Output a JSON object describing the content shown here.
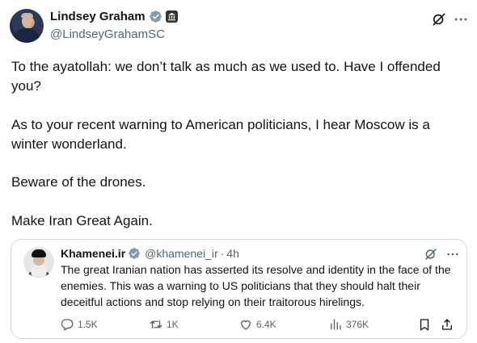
{
  "author": {
    "display_name": "Lindsey Graham",
    "handle": "@LindseyGrahamSC",
    "verified_color": "#829aab"
  },
  "tweet": {
    "paragraphs": [
      "To the ayatollah: we don’t talk as much as we used to. Have I offended you?",
      "As to your recent warning to American politicians, I hear Moscow is a winter wonderland.",
      "Beware of the drones.",
      "Make Iran Great Again."
    ]
  },
  "quoted": {
    "display_name": "Khamenei.ir",
    "handle": "@khamenei_ir",
    "separator": "·",
    "time": "4h",
    "text": "The great Iranian nation has asserted its resolve and identity in the face of the enemies. This was a warning to US politicians that they should halt their deceitful actions and stop relying on their traitorous hirelings.",
    "actions": {
      "replies": "1.5K",
      "reposts": "1K",
      "likes": "6.4K",
      "views": "376K"
    }
  },
  "icons": {
    "verified": "verified-badge-icon",
    "gov": "government-badge-icon",
    "grok": "grok-icon",
    "more": "more-icon",
    "reply": "reply-icon",
    "repost": "repost-icon",
    "like": "like-icon",
    "views": "views-icon",
    "bookmark": "bookmark-icon",
    "share": "share-icon"
  },
  "colors": {
    "text": "#0f1419",
    "secondary": "#536471",
    "border": "#cfd9de"
  }
}
